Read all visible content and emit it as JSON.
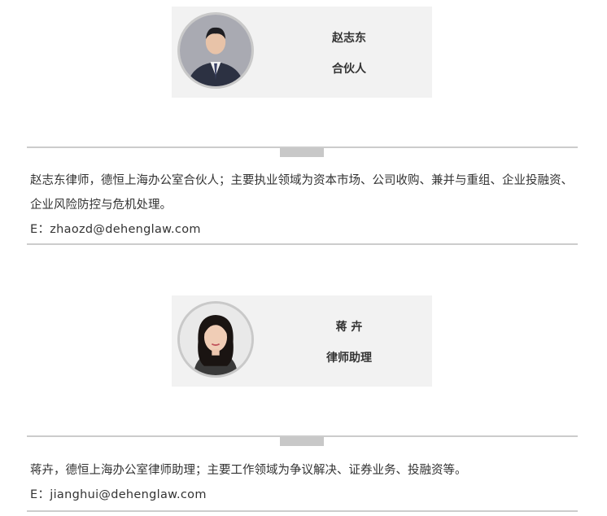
{
  "people": [
    {
      "name": "赵志东",
      "title": "合伙人",
      "bio": "赵志东律师，德恒上海办公室合伙人；主要执业领域为资本市场、公司收购、兼并与重组、企业投融资、企业风险防控与危机处理。",
      "email": "E：zhaozd@dehenglaw.com"
    },
    {
      "name": "蒋 卉",
      "title": "律师助理",
      "bio": "蒋卉，德恒上海办公室律师助理；主要工作领域为争议解决、证券业务、投融资等。",
      "email": "E：jianghui@dehenglaw.com"
    }
  ]
}
